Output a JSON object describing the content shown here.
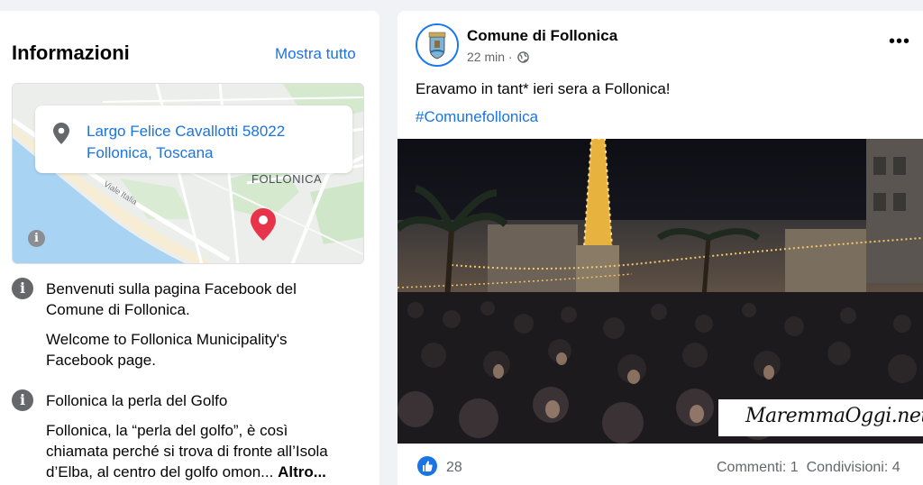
{
  "info": {
    "title": "Informazioni",
    "show_all": "Mostra tutto",
    "address_line1": "Largo Felice Cavallotti 58022",
    "address_line2": "Follonica, Toscana",
    "map_city_label": "FOLLONICA",
    "map_road_label": "Viale Italia",
    "desc1_line1": "Benvenuti sulla pagina Facebook del",
    "desc1_line2": "Comune di Follonica.",
    "desc1_line3": "Welcome to Follonica Municipality's",
    "desc1_line4": "Facebook page.",
    "desc2_title": "Follonica la perla del Golfo",
    "desc2_line1": "Follonica, la “perla del golfo”, è così",
    "desc2_line2": "chiamata perché si trova di fronte all’Isola",
    "desc2_line3": "d’Elba, al centro del golfo omon...",
    "desc2_more": "Altro..."
  },
  "post": {
    "page_name": "Comune di Follonica",
    "time": "22 min",
    "audience_icon": "globe-icon",
    "text": "Eravamo in tant* ieri sera a Follonica!",
    "hashtag": "#Comunefollonica",
    "watermark": "MaremmaOggi.net",
    "like_count": "28",
    "comments": "Commenti: 1",
    "shares": "Condivisioni: 4"
  },
  "colors": {
    "link": "#1b74e4",
    "secondary_text": "#65676b",
    "background": "#f0f2f5",
    "map_pin": "#e8344a"
  }
}
